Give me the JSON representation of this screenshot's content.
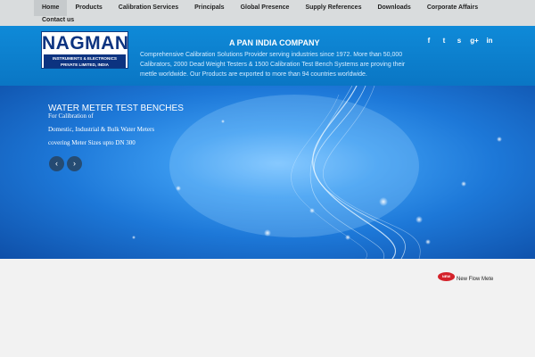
{
  "nav": {
    "items": [
      "Home",
      "Products",
      "Calibration Services",
      "Principals",
      "Global Presence",
      "Supply References",
      "Downloads",
      "Corporate Affairs"
    ],
    "second_row": "Contact us"
  },
  "header": {
    "logo": {
      "word": "NAGMAN",
      "line1": "INSTRUMENTS & ELECTRONICS",
      "line2": "PRIVATE LIMITED, INDIA"
    },
    "tagline": "A PAN INDIA COMPANY",
    "intro": "Comprehensive Calibration Solutions Provider serving industries since 1972. More than 50,000 Calibrators, 2000 Dead Weight Testers & 1500 Calibration Test Bench Systems are proving their mettle worldwide. Our Products are exported to more than 94 countries worldwide.",
    "social": {
      "icons": [
        "facebook-icon",
        "twitter-icon",
        "skype-icon",
        "google-plus-icon",
        "linkedin-icon"
      ],
      "glyphs": [
        "f",
        "t",
        "s",
        "g+",
        "in"
      ]
    }
  },
  "hero": {
    "title": "WATER METER TEST BENCHES",
    "lines": [
      "For Calibration of",
      "Domestic, Industrial & Bulk Water Meters",
      "covering Meter Sizes upto DN 300"
    ],
    "prev_glyph": "‹",
    "next_glyph": "›"
  },
  "news": {
    "badge": "NEW",
    "text": "New Flow Mete"
  },
  "colors": {
    "header_blue": "#0a7fcf",
    "nav_bg": "#d9dcdd",
    "logo_navy": "#0c3380",
    "badge_red": "#d4222a"
  }
}
